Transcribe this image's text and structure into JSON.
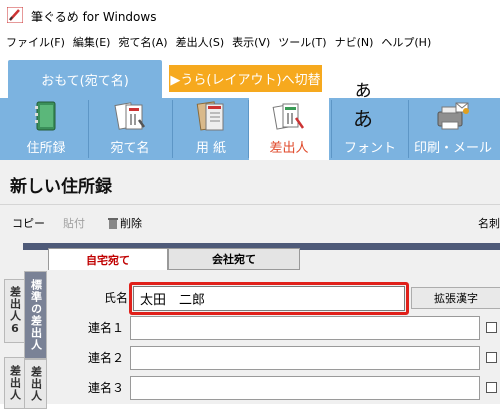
{
  "window": {
    "title": "筆ぐるめ for Windows"
  },
  "menu": [
    "ファイル(F)",
    "編集(E)",
    "宛て名(A)",
    "差出人(S)",
    "表示(V)",
    "ツール(T)",
    "ナビ(N)",
    "ヘルプ(H)"
  ],
  "top_tabs": {
    "omote": "おもて(宛て名)",
    "ura": "▶うら(レイアウト)へ切替"
  },
  "ribbon": [
    {
      "label": "住所録",
      "icon": "address-book-icon"
    },
    {
      "label": "宛て名",
      "icon": "postcard-icon"
    },
    {
      "label": "用 紙",
      "icon": "paper-icon"
    },
    {
      "label": "差出人",
      "icon": "sender-icon",
      "active": true
    },
    {
      "label": "フォント",
      "icon": "font-icon",
      "glyph": "ぁあ"
    },
    {
      "label": "印刷・メール",
      "icon": "printer-icon"
    }
  ],
  "page": {
    "title": "新しい住所録"
  },
  "toolbar": {
    "copy": "コピー",
    "paste": "貼付",
    "delete": "削除",
    "business_card": "名刺"
  },
  "side_tabs": [
    {
      "label": "差出人6"
    },
    {
      "label": "標準の差出人",
      "active": true
    },
    {
      "label": "差出人"
    },
    {
      "label": "差出人"
    }
  ],
  "inner_tabs": {
    "home": "自宅宛て",
    "company": "会社宛て"
  },
  "form": {
    "name_label": "氏名",
    "name_value": "太田　二郎",
    "kakucho_button": "拡張漢字",
    "renmei1_label": "連名１",
    "renmei2_label": "連名２",
    "renmei3_label": "連名３"
  },
  "colors": {
    "ribbon": "#7cb3e0",
    "ura_tab": "#f6a91e",
    "active_label": "#e04a2b",
    "highlight": "#e0201a"
  }
}
